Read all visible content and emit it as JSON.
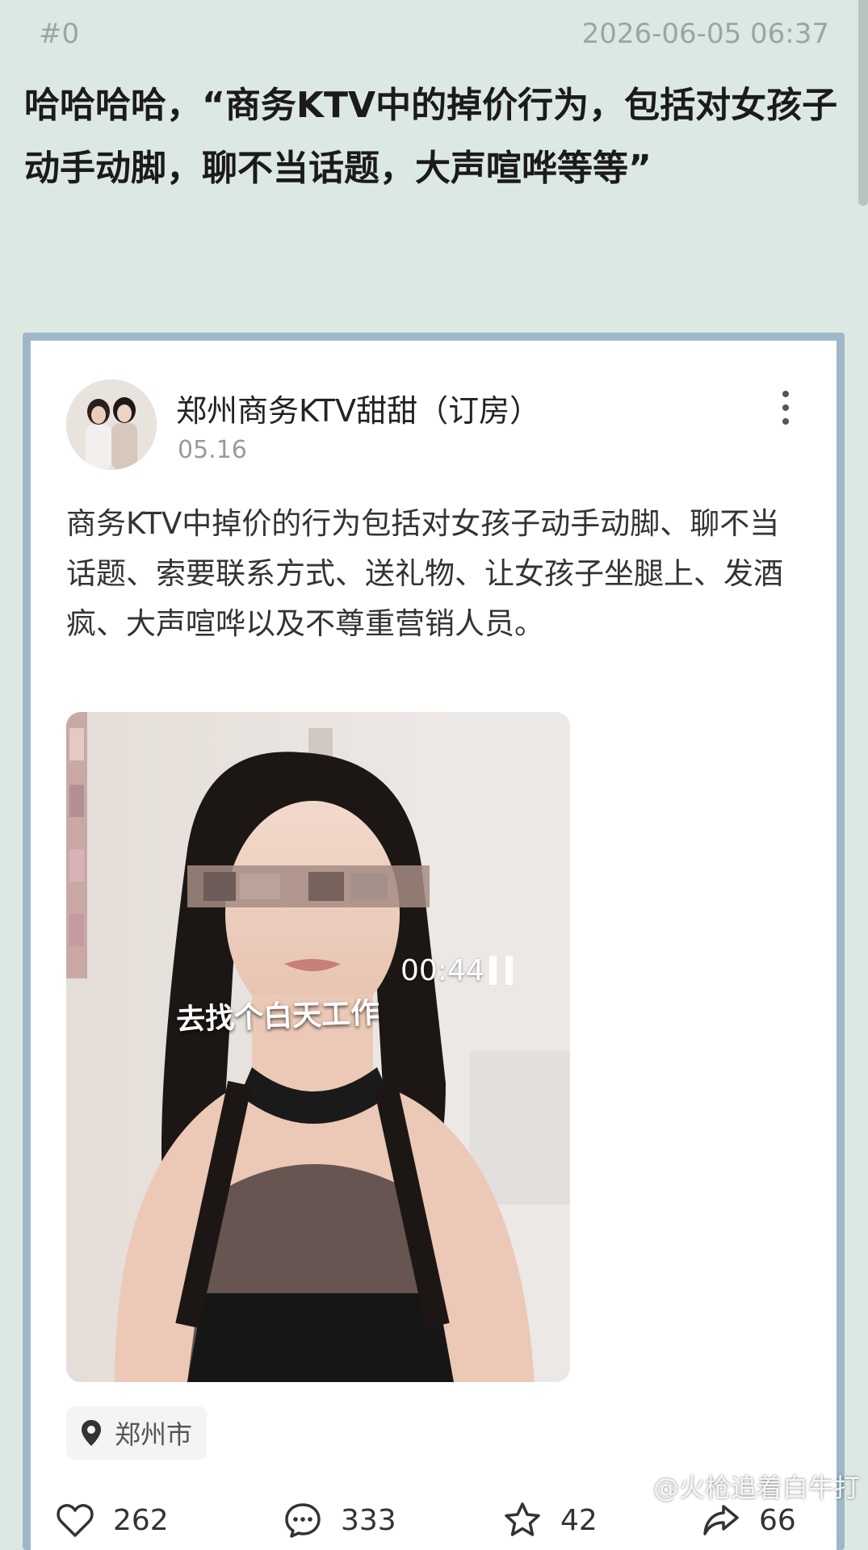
{
  "thread": {
    "index": "#0",
    "timestamp": "2026-06-05 06:37",
    "text": "哈哈哈哈，“商务KTV中的掉价行为，包括对女孩子动手动脚，聊不当话题，大声喧哗等等”"
  },
  "embedded_post": {
    "author": "郑州商务KTV甜甜（订房）",
    "date": "05.16",
    "body": "商务KTV中掉价的行为包括对女孩子动手动脚、聊不当话题、索要联系方式、送礼物、让女孩子坐腿上、发酒疯、大声喧哗以及不尊重营销人员。",
    "video": {
      "elapsed": "00:44",
      "subtitle": "去找个白天工作"
    },
    "location": "郑州市",
    "actions": {
      "likes": "262",
      "comments": "333",
      "favorites": "42",
      "shares": "66"
    }
  },
  "watermark": "@火枪追着白牛打",
  "colors": {
    "page_background": "#dce9e2",
    "card_border": "#9fb8c8",
    "card_background": "#ffffff",
    "meta_text": "#9aa6a0"
  },
  "icons": [
    "more-vertical-icon",
    "pause-icon",
    "location-pin-icon",
    "heart-icon",
    "comment-icon",
    "star-icon",
    "share-icon",
    "weibo-logo-icon"
  ]
}
